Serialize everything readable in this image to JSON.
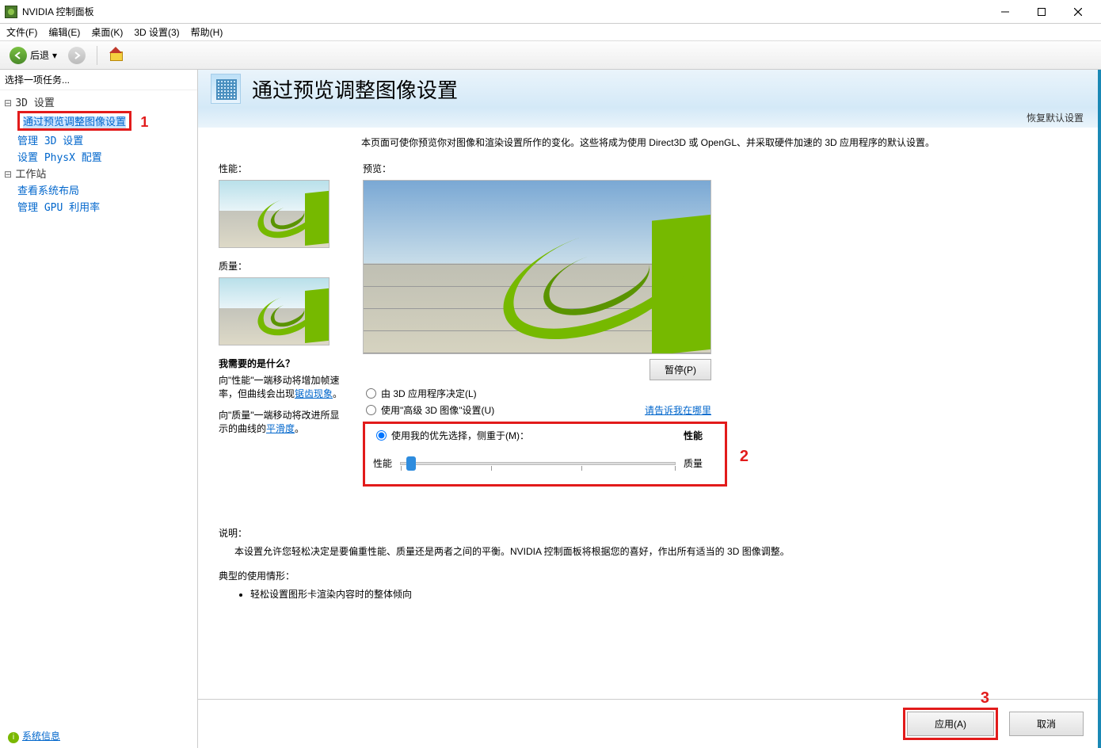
{
  "window": {
    "title": "NVIDIA 控制面板"
  },
  "menu": {
    "file": "文件(F)",
    "edit": "编辑(E)",
    "desktop": "桌面(K)",
    "settings3d": "3D 设置(3)",
    "help": "帮助(H)"
  },
  "toolbar": {
    "back": "后退"
  },
  "tree": {
    "task_label": "选择一项任务...",
    "group_3d": "3D 设置",
    "item_preview": "通过预览调整图像设置",
    "item_manage3d": "管理 3D 设置",
    "item_physx": "设置 PhysX 配置",
    "group_ws": "工作站",
    "item_syslayout": "查看系统布局",
    "item_gpuutil": "管理 GPU 利用率"
  },
  "annotations": {
    "n1": "1",
    "n2": "2",
    "n3": "3"
  },
  "header": {
    "title": "通过预览调整图像设置",
    "restore": "恢复默认设置"
  },
  "intro": "本页面可使你预览你对图像和渲染设置所作的变化。这些将成为使用 Direct3D 或 OpenGL、并采取硬件加速的 3D 应用程序的默认设置。",
  "labels": {
    "perf": "性能：",
    "quality": "质量：",
    "preview": "预览：",
    "pause": "暂停(P)"
  },
  "help": {
    "title": "我需要的是什么？",
    "p1a": "向\"性能\"一端移动将增加帧速率，但曲线会出现",
    "p1link": "锯齿现象",
    "p1b": "。",
    "p2a": "向\"质量\"一端移动将改进所显示的曲线的",
    "p2link": "平滑度",
    "p2b": "。"
  },
  "radios": {
    "r1": "由 3D 应用程序决定(L)",
    "r2": "使用\"高级 3D 图像\"设置(U)",
    "r3": "使用我的优先选择，侧重于(M)：",
    "tell": "请告诉我在哪里",
    "perf_header": "性能",
    "slider_left": "性能",
    "slider_right": "质量"
  },
  "desc": {
    "hd1": "说明：",
    "txt1": "本设置允许您轻松决定是要偏重性能、质量还是两者之间的平衡。NVIDIA 控制面板将根据您的喜好，作出所有适当的 3D 图像调整。",
    "hd2": "典型的使用情形：",
    "li1": "轻松设置图形卡渲染内容时的整体倾向"
  },
  "footer": {
    "apply": "应用(A)",
    "cancel": "取消",
    "sysinfo": "系统信息"
  }
}
